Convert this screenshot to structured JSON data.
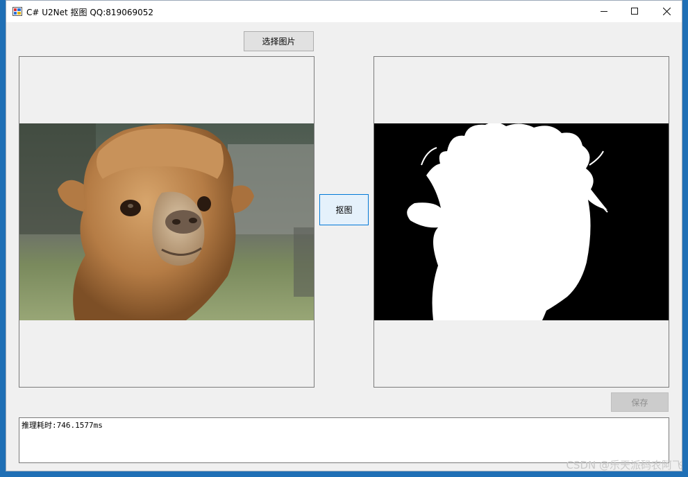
{
  "window": {
    "title": "C# U2Net 抠图 QQ:819069052"
  },
  "buttons": {
    "select_image": "选择图片",
    "matting": "抠图",
    "save": "保存"
  },
  "log": {
    "text": "推理耗时:746.1577ms"
  },
  "watermark": "CSDN @乐天派码农阿飞",
  "icons": {
    "app": "app-icon",
    "minimize": "minimize-icon",
    "maximize": "maximize-icon",
    "close": "close-icon"
  },
  "colors": {
    "window_bg": "#f0f0f0",
    "accent_border": "#0078d7",
    "mask_background": "#000000",
    "mask_foreground": "#ffffff"
  }
}
